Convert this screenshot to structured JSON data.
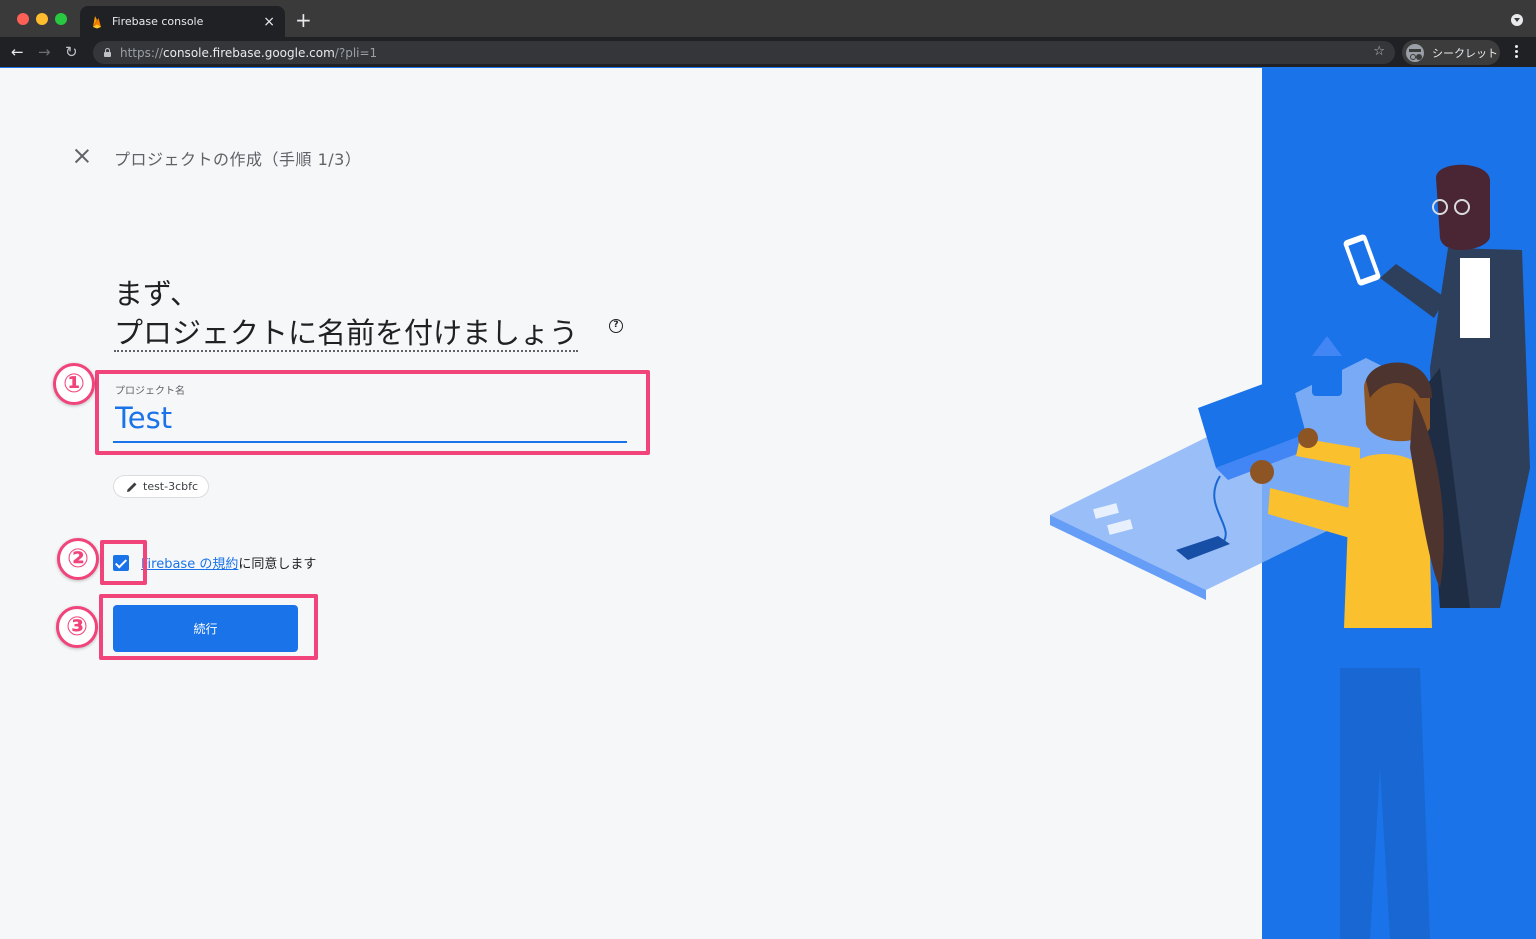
{
  "browser": {
    "tab_title": "Firebase console",
    "tab_close": "×",
    "new_tab": "+",
    "url_prefix": "https://",
    "url_host": "console.firebase.google.com",
    "url_path": "/?pli=1",
    "incognito_label": "シークレット"
  },
  "page": {
    "close_icon": "close-icon",
    "step_title": "プロジェクトの作成（手順 1/3）",
    "heading_line1": "まず、",
    "heading_line2": "プロジェクトに名前を付けましょう",
    "help_icon_glyph": "?",
    "project_name_label": "プロジェクト名",
    "project_name_value": "Test",
    "project_id": "test-3cbfc",
    "terms_link": "Firebase の規約",
    "terms_suffix": "に同意します",
    "terms_checked": true,
    "continue_label": "続行"
  },
  "annotations": {
    "step1": "①",
    "step2": "②",
    "step3": "③",
    "color": "#f0447b"
  },
  "colors": {
    "accent": "#1a73e8",
    "page_bg": "#f6f7f9",
    "toolbar_bg": "#202124"
  }
}
